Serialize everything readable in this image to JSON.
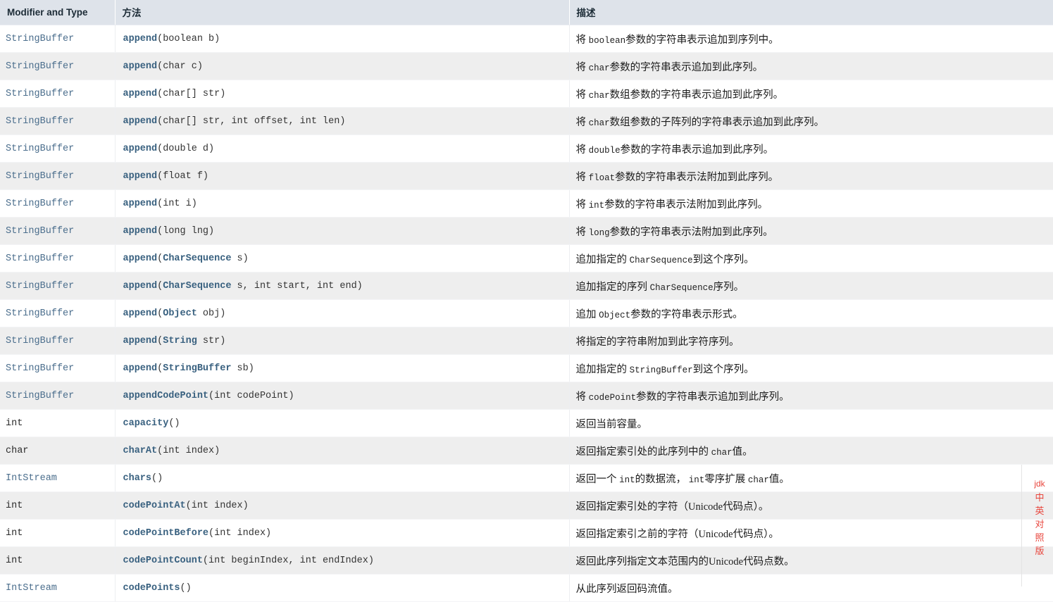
{
  "table": {
    "headers": {
      "type": "Modifier and Type",
      "method": "方法",
      "description": "描述"
    },
    "rows": [
      {
        "type": "StringBuffer",
        "type_is_link": true,
        "method_name": "append",
        "method_args_pre": "(boolean b)",
        "desc_parts": [
          {
            "t": "将 ",
            "code": false
          },
          {
            "t": "boolean",
            "code": true
          },
          {
            "t": "参数的字符串表示追加到序列中。",
            "code": false
          }
        ]
      },
      {
        "type": "StringBuffer",
        "type_is_link": true,
        "method_name": "append",
        "method_args_pre": "(char c)",
        "desc_parts": [
          {
            "t": "将 ",
            "code": false
          },
          {
            "t": "char",
            "code": true
          },
          {
            "t": "参数的字符串表示追加到此序列。",
            "code": false
          }
        ]
      },
      {
        "type": "StringBuffer",
        "type_is_link": true,
        "method_name": "append",
        "method_args_pre": "(char[] str)",
        "desc_parts": [
          {
            "t": "将 ",
            "code": false
          },
          {
            "t": "char",
            "code": true
          },
          {
            "t": "数组参数的字符串表示追加到此序列。",
            "code": false
          }
        ]
      },
      {
        "type": "StringBuffer",
        "type_is_link": true,
        "method_name": "append",
        "method_args_pre": "(char[] str, int offset, int len)",
        "desc_parts": [
          {
            "t": "将 ",
            "code": false
          },
          {
            "t": "char",
            "code": true
          },
          {
            "t": "数组参数的子阵列的字符串表示追加到此序列。",
            "code": false
          }
        ]
      },
      {
        "type": "StringBuffer",
        "type_is_link": true,
        "method_name": "append",
        "method_args_pre": "(double d)",
        "desc_parts": [
          {
            "t": "将 ",
            "code": false
          },
          {
            "t": "double",
            "code": true
          },
          {
            "t": "参数的字符串表示追加到此序列。",
            "code": false
          }
        ]
      },
      {
        "type": "StringBuffer",
        "type_is_link": true,
        "method_name": "append",
        "method_args_pre": "(float f)",
        "desc_parts": [
          {
            "t": "将 ",
            "code": false
          },
          {
            "t": "float",
            "code": true
          },
          {
            "t": "参数的字符串表示法附加到此序列。",
            "code": false
          }
        ]
      },
      {
        "type": "StringBuffer",
        "type_is_link": true,
        "method_name": "append",
        "method_args_pre": "(int i)",
        "desc_parts": [
          {
            "t": "将 ",
            "code": false
          },
          {
            "t": "int",
            "code": true
          },
          {
            "t": "参数的字符串表示法附加到此序列。",
            "code": false
          }
        ]
      },
      {
        "type": "StringBuffer",
        "type_is_link": true,
        "method_name": "append",
        "method_args_pre": "(long lng)",
        "desc_parts": [
          {
            "t": "将 ",
            "code": false
          },
          {
            "t": "long",
            "code": true
          },
          {
            "t": "参数的字符串表示法附加到此序列。",
            "code": false
          }
        ]
      },
      {
        "type": "StringBuffer",
        "type_is_link": true,
        "method_name": "append",
        "method_args_pre": "(",
        "method_arg_link": "CharSequence",
        "method_args_post": " s)",
        "desc_parts": [
          {
            "t": "追加指定的 ",
            "code": false
          },
          {
            "t": "CharSequence",
            "code": true
          },
          {
            "t": "到这个序列。",
            "code": false
          }
        ]
      },
      {
        "type": "StringBuffer",
        "type_is_link": true,
        "method_name": "append",
        "method_args_pre": "(",
        "method_arg_link": "CharSequence",
        "method_args_post": " s, int start, int end)",
        "desc_parts": [
          {
            "t": "追加指定的序列 ",
            "code": false
          },
          {
            "t": "CharSequence",
            "code": true
          },
          {
            "t": "序列。",
            "code": false
          }
        ]
      },
      {
        "type": "StringBuffer",
        "type_is_link": true,
        "method_name": "append",
        "method_args_pre": "(",
        "method_arg_link": "Object",
        "method_args_post": " obj)",
        "desc_parts": [
          {
            "t": "追加 ",
            "code": false
          },
          {
            "t": "Object",
            "code": true
          },
          {
            "t": "参数的字符串表示形式。",
            "code": false
          }
        ]
      },
      {
        "type": "StringBuffer",
        "type_is_link": true,
        "method_name": "append",
        "method_args_pre": "(",
        "method_arg_link": "String",
        "method_args_post": " str)",
        "desc_parts": [
          {
            "t": "将指定的字符串附加到此字符序列。",
            "code": false
          }
        ]
      },
      {
        "type": "StringBuffer",
        "type_is_link": true,
        "method_name": "append",
        "method_args_pre": "(",
        "method_arg_link": "StringBuffer",
        "method_args_post": " sb)",
        "desc_parts": [
          {
            "t": "追加指定的 ",
            "code": false
          },
          {
            "t": "StringBuffer",
            "code": true
          },
          {
            "t": "到这个序列。",
            "code": false
          }
        ]
      },
      {
        "type": "StringBuffer",
        "type_is_link": true,
        "method_name": "appendCodePoint",
        "method_args_pre": "(int codePoint)",
        "desc_parts": [
          {
            "t": "将 ",
            "code": false
          },
          {
            "t": "codePoint",
            "code": true
          },
          {
            "t": "参数的字符串表示追加到此序列。",
            "code": false
          }
        ]
      },
      {
        "type": "int",
        "type_is_link": false,
        "method_name": "capacity",
        "method_args_pre": "()",
        "desc_parts": [
          {
            "t": "返回当前容量。",
            "code": false
          }
        ]
      },
      {
        "type": "char",
        "type_is_link": false,
        "method_name": "charAt",
        "method_args_pre": "(int index)",
        "desc_parts": [
          {
            "t": "返回指定索引处的此序列中的 ",
            "code": false
          },
          {
            "t": "char",
            "code": true
          },
          {
            "t": "值。",
            "code": false
          }
        ]
      },
      {
        "type": "IntStream",
        "type_is_link": true,
        "method_name": "chars",
        "method_args_pre": "()",
        "desc_parts": [
          {
            "t": "返回一个 ",
            "code": false
          },
          {
            "t": "int",
            "code": true
          },
          {
            "t": "的数据流， ",
            "code": false
          },
          {
            "t": "int",
            "code": true
          },
          {
            "t": "零序扩展 ",
            "code": false
          },
          {
            "t": "char",
            "code": true
          },
          {
            "t": "值。",
            "code": false
          }
        ]
      },
      {
        "type": "int",
        "type_is_link": false,
        "method_name": "codePointAt",
        "method_args_pre": "(int index)",
        "desc_parts": [
          {
            "t": "返回指定索引处的字符（Unicode代码点）。",
            "code": false
          }
        ]
      },
      {
        "type": "int",
        "type_is_link": false,
        "method_name": "codePointBefore",
        "method_args_pre": "(int index)",
        "desc_parts": [
          {
            "t": "返回指定索引之前的字符（Unicode代码点）。",
            "code": false
          }
        ]
      },
      {
        "type": "int",
        "type_is_link": false,
        "method_name": "codePointCount",
        "method_args_pre": "(int beginIndex, int endIndex)",
        "desc_parts": [
          {
            "t": "返回此序列指定文本范围内的Unicode代码点数。",
            "code": false
          }
        ]
      },
      {
        "type": "IntStream",
        "type_is_link": true,
        "method_name": "codePoints",
        "method_args_pre": "()",
        "desc_parts": [
          {
            "t": "从此序列返回码流值。",
            "code": false
          }
        ]
      }
    ]
  },
  "watermark": {
    "chars": [
      "jdk",
      "中",
      "英",
      "对",
      "照",
      "版"
    ],
    "color": "#e8453c"
  },
  "colors": {
    "header_background": "#dee3ea",
    "row_even_background": "#eeeeee",
    "row_odd_background": "#ffffff",
    "link": "#4a6d8c",
    "text": "#1b1b1b"
  }
}
